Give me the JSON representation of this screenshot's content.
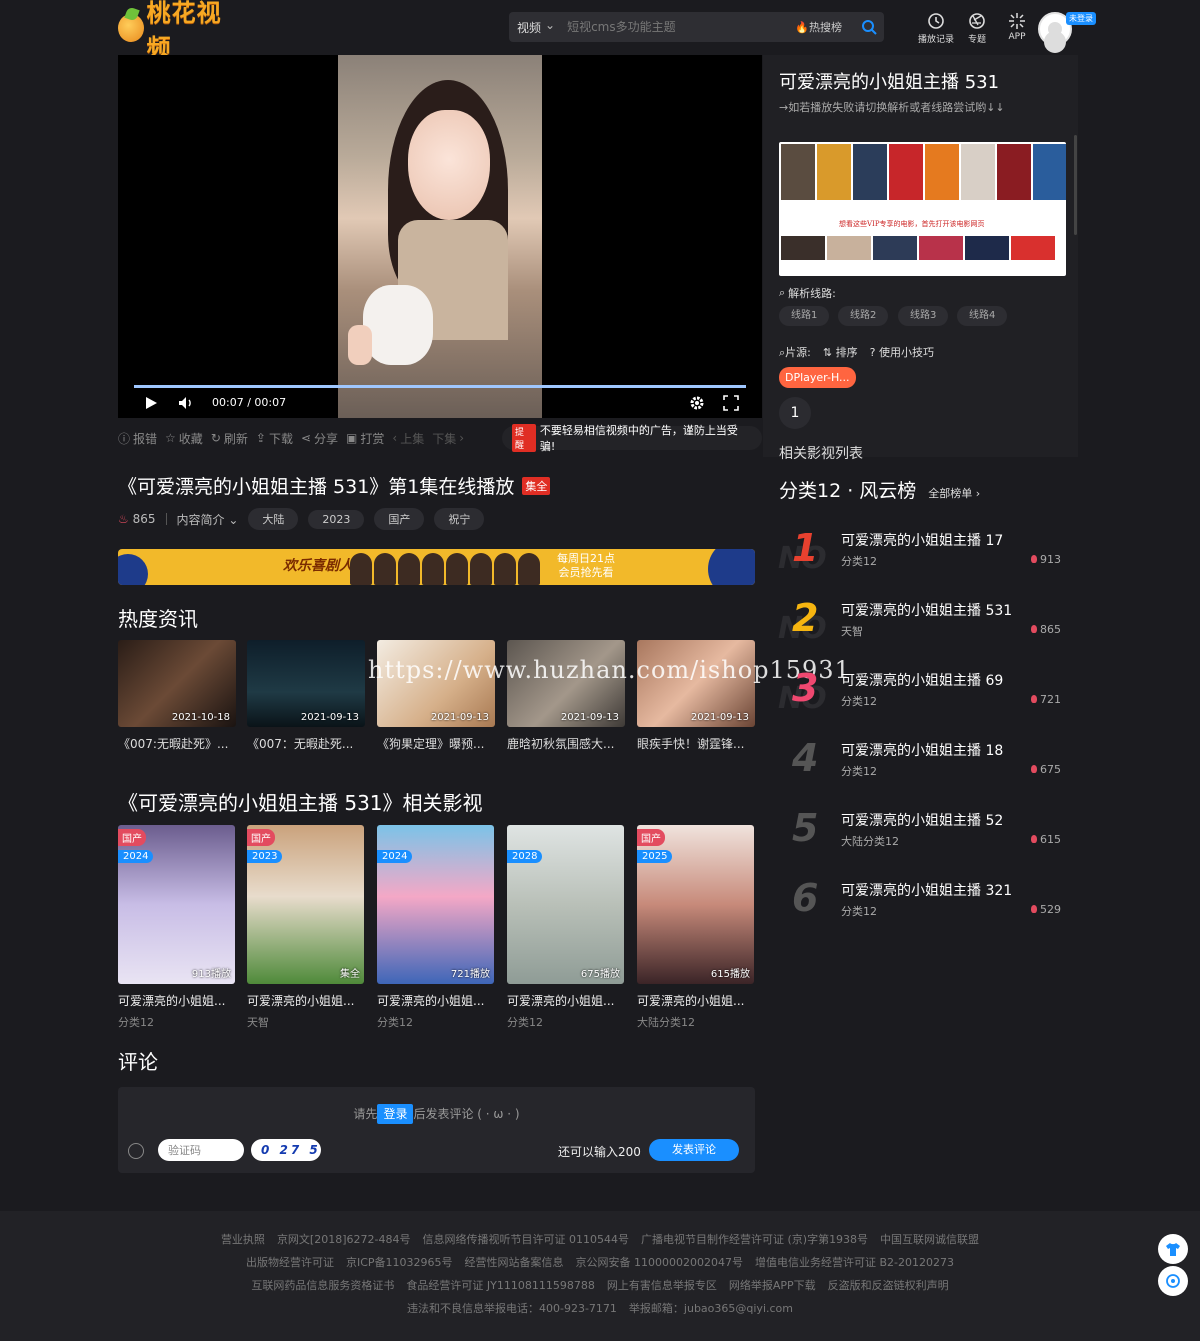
{
  "header": {
    "logo_text": "桃花视频",
    "search_category": "视频",
    "search_placeholder": "短视cms多功能主题",
    "hot_label": "热搜榜",
    "history_label": "播放记录",
    "topic_label": "专题",
    "app_label": "APP",
    "login_badge": "未登录"
  },
  "player": {
    "time": "00:07 / 00:07",
    "progress": 1.0
  },
  "toolbar": {
    "report": "报错",
    "favorite": "收藏",
    "refresh": "刷新",
    "download": "下载",
    "share": "分享",
    "reward": "打赏",
    "prev": "上集",
    "next": "下集",
    "notice_tag": "提醒",
    "notice_text": "不要轻易相信视频中的广告，谨防上当受骗!"
  },
  "video": {
    "title": "《可爱漂亮的小姐姐主播 531》第1集在线播放",
    "badge": "集全",
    "hot": "865",
    "intro": "内容简介",
    "tags": [
      "大陆",
      "2023",
      "国产",
      "祝宁"
    ]
  },
  "banner": {
    "logo": "欢乐喜剧人",
    "line1": "每周日21点",
    "line2": "会员抢先看"
  },
  "news": {
    "heading": "热度资讯",
    "items": [
      {
        "date": "2021-10-18",
        "title": "《007:无暇赴死》..."
      },
      {
        "date": "2021-09-13",
        "title": "《007：无暇赴死..."
      },
      {
        "date": "2021-09-13",
        "title": "《狗果定理》曝预..."
      },
      {
        "date": "2021-09-13",
        "title": "鹿晗初秋氛围感大..."
      },
      {
        "date": "2021-09-13",
        "title": "眼疾手快！谢霆锋..."
      }
    ]
  },
  "watermark": "https://www.huzhan.com/ishop15931",
  "related": {
    "heading": "《可爱漂亮的小姐姐主播 531》相关影视",
    "items": [
      {
        "area": "国产",
        "year": "2024",
        "plays": "913播放",
        "title": "可爱漂亮的小姐姐...",
        "cat": "分类12"
      },
      {
        "area": "国产",
        "year": "2023",
        "plays": "集全",
        "title": "可爱漂亮的小姐姐...",
        "cat": "天智"
      },
      {
        "area": "",
        "year": "2024",
        "plays": "721播放",
        "title": "可爱漂亮的小姐姐...",
        "cat": "分类12"
      },
      {
        "area": "",
        "year": "2028",
        "plays": "675播放",
        "title": "可爱漂亮的小姐姐...",
        "cat": "分类12"
      },
      {
        "area": "国产",
        "year": "2025",
        "plays": "615播放",
        "title": "可爱漂亮的小姐姐...",
        "cat": "大陆分类12"
      }
    ]
  },
  "comments": {
    "heading": "评论",
    "hint_before": "请先",
    "login": "登录",
    "hint_after": "后发表评论 ( · ω · )",
    "captcha_placeholder": "验证码",
    "captcha_code": "0 27 5",
    "remaining": "还可以输入200",
    "submit": "发表评论"
  },
  "side": {
    "title": "可爱漂亮的小姐姐主播 531",
    "tip": "→如若播放失败请切换解析或者线路尝试哟↓↓",
    "preview_note": "想看这些VIP专享的电影，首先打开该电影网页",
    "parse_label": "解析线路:",
    "lines": [
      "线路1",
      "线路2",
      "线路3",
      "线路4"
    ],
    "source_label": "片源:",
    "sort_label": "排序",
    "tips_label": "使用小技巧",
    "source_name": "DPlayer-H...",
    "episode": "1",
    "related_list": "相关影视列表",
    "rank_title": "分类12 · 风云榜",
    "rank_all": "全部榜单",
    "rank": [
      {
        "num": "1",
        "name": "可爱漂亮的小姐姐主播 17",
        "cat": "分类12",
        "hot": "913"
      },
      {
        "num": "2",
        "name": "可爱漂亮的小姐姐主播 531",
        "cat": "天智",
        "hot": "865"
      },
      {
        "num": "3",
        "name": "可爱漂亮的小姐姐主播 69",
        "cat": "分类12",
        "hot": "721"
      },
      {
        "num": "4",
        "name": "可爱漂亮的小姐姐主播 18",
        "cat": "分类12",
        "hot": "675"
      },
      {
        "num": "5",
        "name": "可爱漂亮的小姐姐主播 52",
        "cat": "大陆分类12",
        "hot": "615"
      },
      {
        "num": "6",
        "name": "可爱漂亮的小姐姐主播 321",
        "cat": "分类12",
        "hot": "529"
      }
    ]
  },
  "footer": {
    "row1": [
      "营业执照",
      "京网文[2018]6272-484号",
      "信息网络传播视听节目许可证 0110544号",
      "广播电视节目制作经营许可证 (京)字第1938号",
      "中国互联网诚信联盟"
    ],
    "row2": [
      "出版物经营许可证",
      "京ICP备11032965号",
      "经营性网站备案信息",
      "京公网安备 11000002002047号",
      "增值电信业务经营许可证 B2-20120273"
    ],
    "row3": [
      "互联网药品信息服务资格证书",
      "食品经营许可证 JY11108111598788",
      "网上有害信息举报专区",
      "网络举报APP下载",
      "反盗版和反盗链权利声明"
    ],
    "row4": [
      "违法和不良信息举报电话：400-923-7171",
      "举报邮箱：jubao365@qiyi.com"
    ]
  },
  "colors": {
    "bg": "#1b1b1f",
    "accent": "#1a8fff",
    "brand": "#f7a823",
    "rank1": "#e8412f",
    "rank2": "#f6b510",
    "rank3": "#f04870"
  }
}
